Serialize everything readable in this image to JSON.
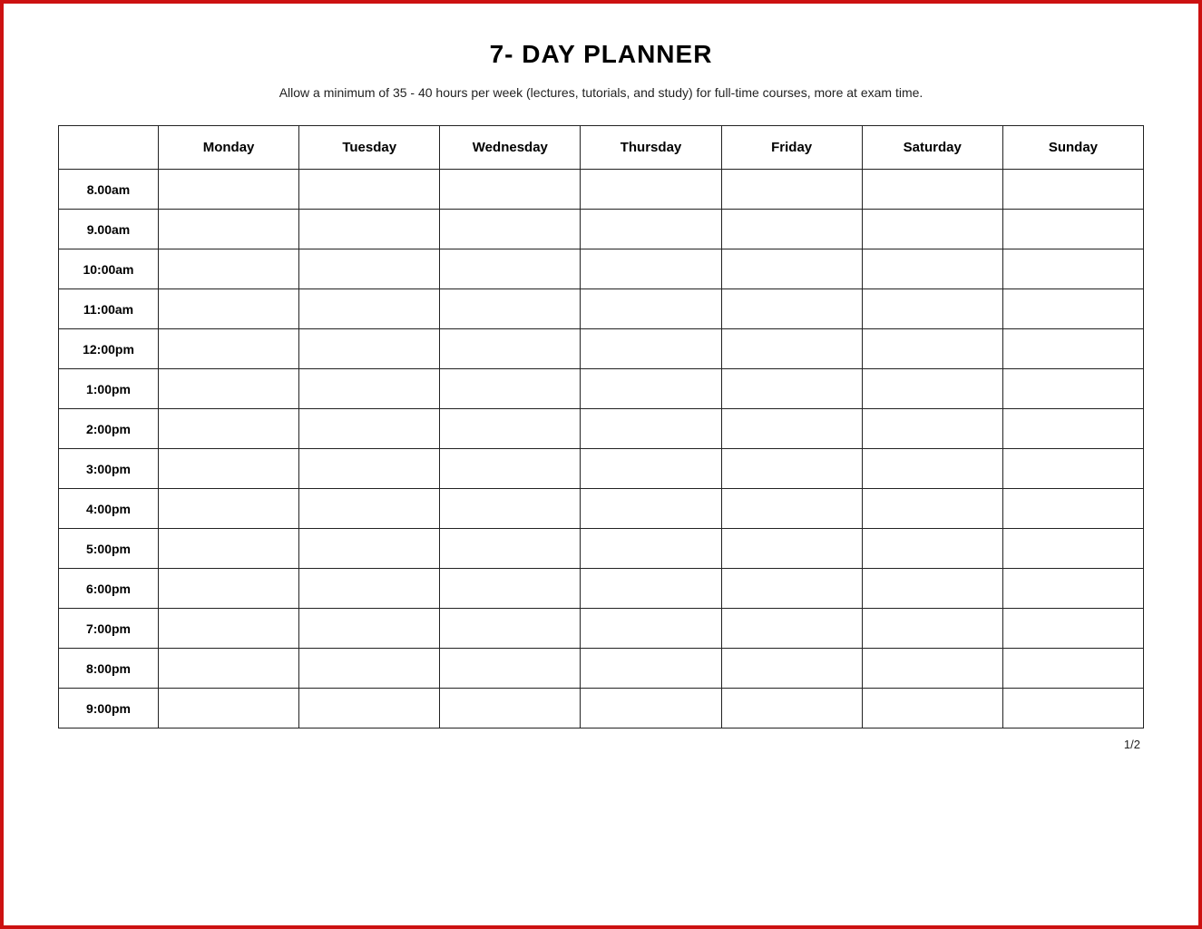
{
  "title": "7- DAY PLANNER",
  "subtitle": "Allow a minimum of 35 - 40 hours per week (lectures, tutorials, and study) for full-time courses, more at exam time.",
  "columns": [
    "",
    "Monday",
    "Tuesday",
    "Wednesday",
    "Thursday",
    "Friday",
    "Saturday",
    "Sunday"
  ],
  "time_slots": [
    "8.00am",
    "9.00am",
    "10:00am",
    "11:00am",
    "12:00pm",
    "1:00pm",
    "2:00pm",
    "3:00pm",
    "4:00pm",
    "5:00pm",
    "6:00pm",
    "7:00pm",
    "8:00pm",
    "9:00pm"
  ],
  "page_num": "1/2"
}
